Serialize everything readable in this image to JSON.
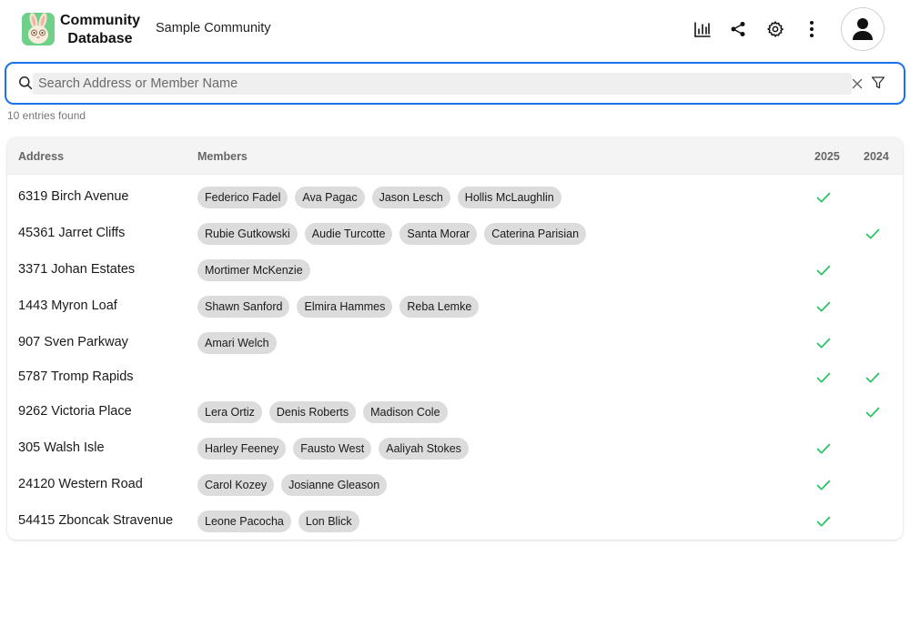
{
  "header": {
    "app_title_line1": "Community",
    "app_title_line2": "Database",
    "community_name": "Sample Community",
    "icons": [
      "chart-icon",
      "share-icon",
      "settings-icon",
      "more-vertical-icon",
      "user-avatar-icon"
    ]
  },
  "search": {
    "placeholder": "Search Address or Member Name",
    "value": ""
  },
  "entries_found": "10 entries found",
  "table": {
    "headers": {
      "address": "Address",
      "members": "Members",
      "year1": "2025",
      "year2": "2024"
    },
    "rows": [
      {
        "address": "6319 Birch Avenue",
        "members": [
          "Federico Fadel",
          "Ava Pagac",
          "Jason Lesch",
          "Hollis McLaughlin"
        ],
        "y2025": true,
        "y2024": false
      },
      {
        "address": "45361 Jarret Cliffs",
        "members": [
          "Rubie Gutkowski",
          "Audie Turcotte",
          "Santa Morar",
          "Caterina Parisian"
        ],
        "y2025": false,
        "y2024": true
      },
      {
        "address": "3371 Johan Estates",
        "members": [
          "Mortimer McKenzie"
        ],
        "y2025": true,
        "y2024": false
      },
      {
        "address": "1443 Myron Loaf",
        "members": [
          "Shawn Sanford",
          "Elmira Hammes",
          "Reba Lemke"
        ],
        "y2025": true,
        "y2024": false
      },
      {
        "address": "907 Sven Parkway",
        "members": [
          "Amari Welch"
        ],
        "y2025": true,
        "y2024": false
      },
      {
        "address": "5787 Tromp Rapids",
        "members": [],
        "y2025": true,
        "y2024": true
      },
      {
        "address": "9262 Victoria Place",
        "members": [
          "Lera Ortiz",
          "Denis Roberts",
          "Madison Cole"
        ],
        "y2025": false,
        "y2024": true
      },
      {
        "address": "305 Walsh Isle",
        "members": [
          "Harley Feeney",
          "Fausto West",
          "Aaliyah Stokes"
        ],
        "y2025": true,
        "y2024": false
      },
      {
        "address": "24120 Western Road",
        "members": [
          "Carol Kozey",
          "Josianne Gleason"
        ],
        "y2025": true,
        "y2024": false
      },
      {
        "address": "54415 Zboncak Stravenue",
        "members": [
          "Leone Pacocha",
          "Lon Blick"
        ],
        "y2025": true,
        "y2024": false
      }
    ]
  },
  "colors": {
    "accent": "#1a73e8",
    "check": "#22c55e",
    "chip": "#dcdcdc",
    "logo_bg": "#6fd08a"
  }
}
